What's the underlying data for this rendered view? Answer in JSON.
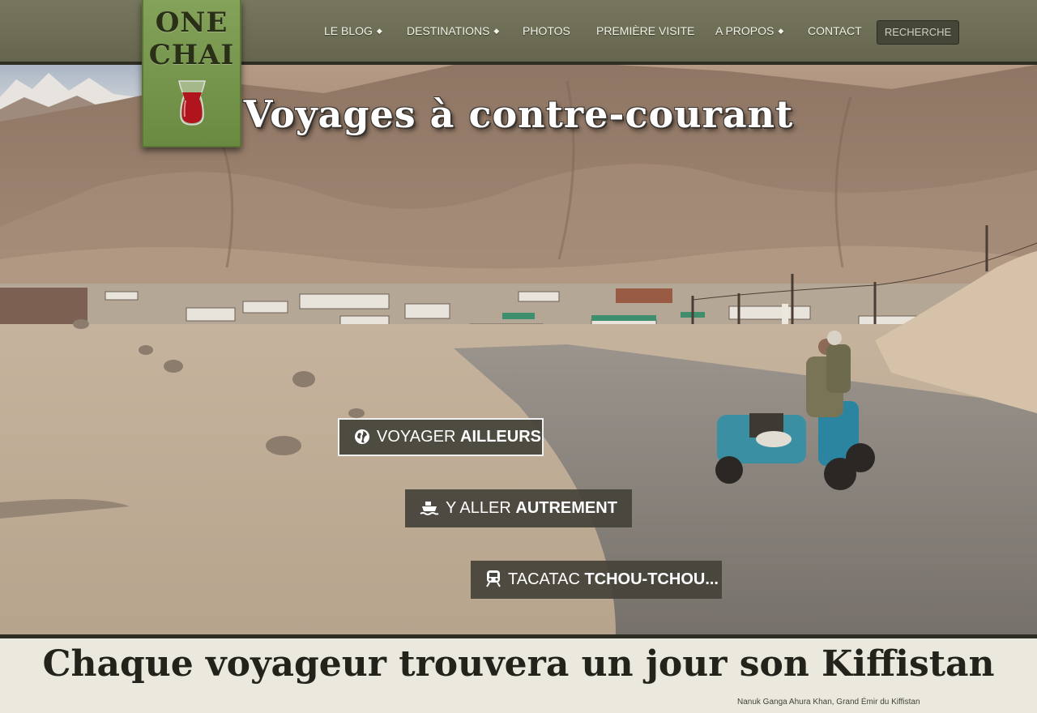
{
  "site": {
    "logo_line1": "ONE",
    "logo_line2": "CHAI"
  },
  "nav": {
    "items": [
      {
        "label": "LE BLOG",
        "has_submenu": true
      },
      {
        "label": "DESTINATIONS",
        "has_submenu": true
      },
      {
        "label": "PHOTOS",
        "has_submenu": false
      },
      {
        "label": "PREMIÈRE VISITE",
        "has_submenu": false
      },
      {
        "label": "A PROPOS",
        "has_submenu": true
      },
      {
        "label": "CONTACT",
        "has_submenu": false
      }
    ],
    "search_label": "RECHERCHE"
  },
  "hero": {
    "title": "Voyages à contre-courant",
    "buttons": [
      {
        "light": "VOYAGER",
        "strong": "AILLEURS",
        "icon": "globe-icon"
      },
      {
        "light": "Y ALLER",
        "strong": "AUTREMENT",
        "icon": "ship-icon"
      },
      {
        "light": "TACATAC",
        "strong": "TCHOU-TCHOU...",
        "icon": "train-icon"
      }
    ]
  },
  "band": {
    "quote": "Chaque voyageur trouvera un jour son Kiffistan",
    "attribution": "Nanuk Ganga Ahura Khan, Grand Émir du Kiffistan"
  },
  "colors": {
    "header_bg": "#6f6f58",
    "logo_green": "#7a9a4e",
    "band_bg": "#ebe9de",
    "button_bg": "#44423a"
  }
}
